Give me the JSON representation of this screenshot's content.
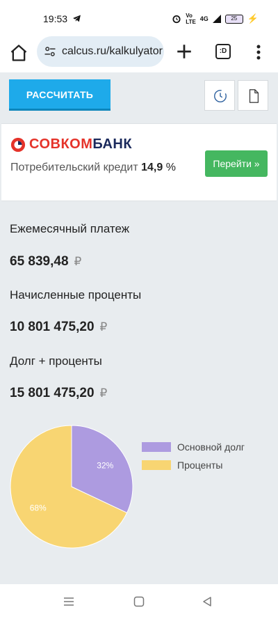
{
  "status": {
    "time": "19:53",
    "network": "4G",
    "battery": "25"
  },
  "browser": {
    "url": "calcus.ru/kalkulyator",
    "tabs_label": ":D"
  },
  "toolbar": {
    "calc_label": "РАССЧИТАТЬ"
  },
  "ad": {
    "bank_name_a": "СОВКОМ",
    "bank_name_b": "БАНК",
    "text": "Потребительский кредит",
    "rate": "14,9",
    "rate_unit": "%",
    "button_label": "Перейти »"
  },
  "results": {
    "monthly_label": "Ежемесячный платеж",
    "monthly_value": "65 839,48",
    "interest_label": "Начисленные проценты",
    "interest_value": "10 801 475,20",
    "total_label": "Долг + проценты",
    "total_value": "15 801 475,20",
    "currency": "₽"
  },
  "chart_data": {
    "type": "pie",
    "categories": [
      "Основной долг",
      "Проценты"
    ],
    "values": [
      32,
      68
    ],
    "labels": [
      "32%",
      "68%"
    ],
    "colors": [
      "#ad9be0",
      "#f8d572"
    ],
    "legend_position": "right"
  }
}
